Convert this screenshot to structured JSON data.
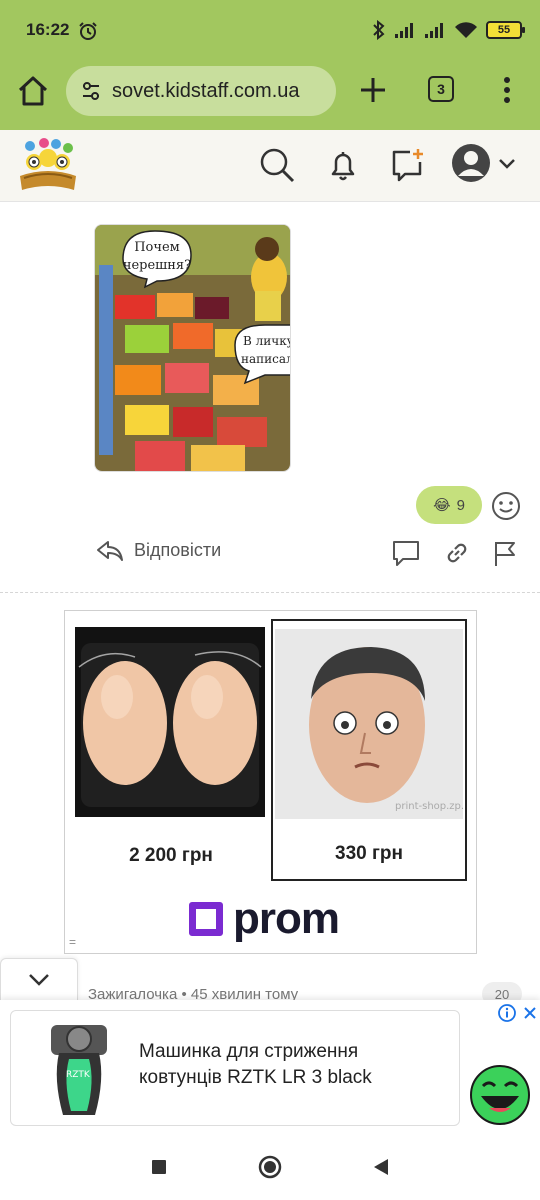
{
  "status": {
    "time": "16:22",
    "battery": "55"
  },
  "browser": {
    "url": "sovet.kidstaff.com.ua",
    "tab_count": "3"
  },
  "post": {
    "image_bubble_1": "Почем черешня?",
    "image_bubble_2": "В личку написала",
    "reaction_emoji": "😂",
    "reaction_count": "9",
    "reply_label": "Відповісти"
  },
  "ad": {
    "items": [
      {
        "price": "2 200 грн"
      },
      {
        "price": "330 грн",
        "watermark": "print-shop.zp.ua"
      }
    ],
    "brand": "prom",
    "menu_glyph": "="
  },
  "next_comment": {
    "text": "Зажигалочка • 45 хвилин тому",
    "count": "20"
  },
  "bottom_ad": {
    "title": "Машинка для стриження ковтунців RZTK LR 3 black",
    "product_brand": "RZTK"
  },
  "colors": {
    "browser_bar": "#a2c75f",
    "url_box": "#c8de9d",
    "reaction_pill": "#c5e07d",
    "prom_purple": "#7b2bd1",
    "adchoice_blue": "#1a73e8"
  }
}
